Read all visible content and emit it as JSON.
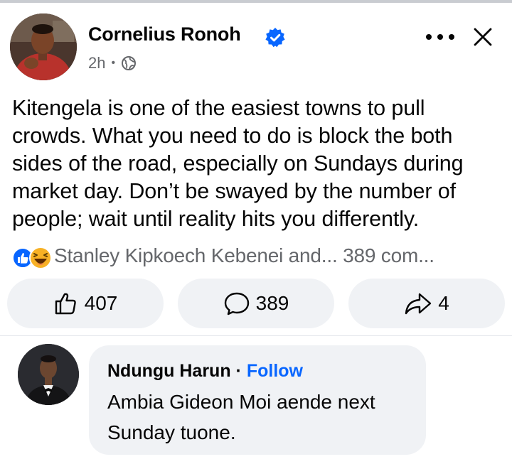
{
  "post": {
    "author": "Cornelius Ronoh",
    "time": "2h",
    "time_separator": "•",
    "body": "Kitengela is one of the easiest towns to pull crowds. What you need to do is block the both sides of the road, especially on Sundays during market day. Don’t be swayed by the number of people; wait until reality hits you differently.",
    "reaction_summary": "Stanley Kipkoech Kebenei and... 389 com...",
    "reaction_icons": [
      "like-icon",
      "haha-icon"
    ],
    "privacy_icon": "globe-icon"
  },
  "actions": {
    "like_count": "407",
    "comment_count": "389",
    "share_count": "4"
  },
  "comment": {
    "author": "Ndungu Harun",
    "separator": "·",
    "follow_label": "Follow",
    "text": "Ambia Gideon Moi aende next Sunday tuone."
  },
  "colors": {
    "accent": "#0866ff",
    "secondary_text": "#65676b",
    "button_bg": "#f0f2f5",
    "haha": "#f7b125"
  }
}
